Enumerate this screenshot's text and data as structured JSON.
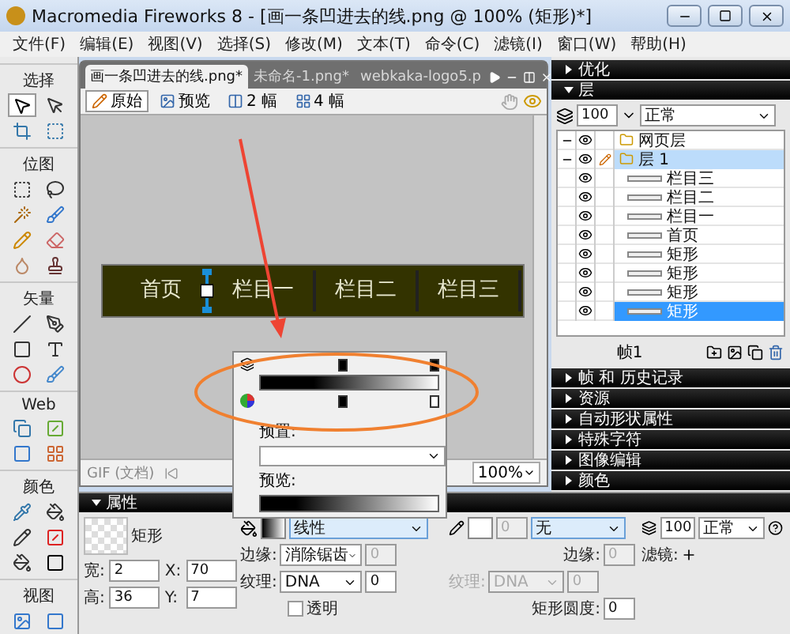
{
  "window": {
    "title": "Macromedia Fireworks 8 - [画一条凹进去的线.png @ 100% (矩形)*]"
  },
  "menu": [
    "文件(F)",
    "编辑(E)",
    "视图(V)",
    "选择(S)",
    "修改(M)",
    "文本(T)",
    "命令(C)",
    "滤镜(I)",
    "窗口(W)",
    "帮助(H)"
  ],
  "tools": [
    {
      "title": "选择"
    },
    {
      "title": "位图"
    },
    {
      "title": "矢量"
    },
    {
      "title": "Web"
    },
    {
      "title": "颜色"
    },
    {
      "title": "视图"
    }
  ],
  "document": {
    "tabs": [
      {
        "label": "画一条凹进去的线.png*",
        "selected": true
      },
      {
        "label": "未命名-1.png*",
        "selected": false
      },
      {
        "label": "webkaka-logo5.p",
        "selected": false
      }
    ],
    "views": [
      {
        "label": "原始",
        "selected": true
      },
      {
        "label": "预览",
        "selected": false
      },
      {
        "label": "2 幅",
        "selected": false
      },
      {
        "label": "4 幅",
        "selected": false
      }
    ],
    "nav_items": [
      "首页",
      "栏目一",
      "栏目二",
      "栏目三"
    ],
    "status_bar": {
      "doc_type": "GIF (文档)",
      "zoom": "100%"
    }
  },
  "gradient_editor": {
    "preset_label": "预置:",
    "preview_label": "预览:"
  },
  "panels": [
    {
      "title": "优化",
      "expanded": false
    },
    {
      "title": "层",
      "expanded": true
    }
  ],
  "layers": {
    "opacity": "100",
    "blend": "正常",
    "items": [
      {
        "name": "网页层",
        "kind": "web",
        "selected": false
      },
      {
        "name": "层 1",
        "kind": "layer",
        "selected": true,
        "children": [
          {
            "name": "栏目三",
            "selected": false
          },
          {
            "name": "栏目二",
            "selected": false
          },
          {
            "name": "栏目一",
            "selected": false
          },
          {
            "name": "首页",
            "selected": false
          },
          {
            "name": "矩形",
            "selected": false
          },
          {
            "name": "矩形",
            "selected": false
          },
          {
            "name": "矩形",
            "selected": false
          },
          {
            "name": "矩形",
            "selected": true
          }
        ]
      }
    ],
    "frame": "帧1"
  },
  "collapsed_panels": [
    {
      "title": "帧 和 历史记录",
      "expanded": false
    },
    {
      "title": "资源",
      "expanded": false
    },
    {
      "title": "自动形状属性",
      "expanded": false
    },
    {
      "title": "特殊字符",
      "expanded": false
    },
    {
      "title": "图像编辑",
      "expanded": false
    },
    {
      "title": "颜色",
      "expanded": false
    }
  ],
  "properties": {
    "title": "属性",
    "expanded": true,
    "object": {
      "name": "矩形",
      "dims": [
        {
          "label": "宽:",
          "value": "2"
        },
        {
          "label": "X:",
          "value": "70"
        },
        {
          "label": "高:",
          "value": "36"
        },
        {
          "label": "Y:",
          "value": "7"
        }
      ]
    },
    "fill": {
      "type": "线性",
      "edge_label": "边缘:",
      "edge": "消除锯齿",
      "edge_amount": "0",
      "texture_label": "纹理:",
      "texture": "DNA",
      "texture_amount": "0",
      "transparent": {
        "label": "透明",
        "checked": false
      }
    },
    "stroke": {
      "amount": "0",
      "type": "无",
      "edge_label": "边缘:",
      "edge_amount": "0",
      "texture_label": "纹理:",
      "texture": "DNA",
      "texture_amount": "0",
      "disabled": true,
      "roundness_label": "矩形圆度:",
      "roundness": "0"
    },
    "effects": {
      "opacity": "100",
      "blend": "正常",
      "filters_label": "滤镜:"
    }
  }
}
